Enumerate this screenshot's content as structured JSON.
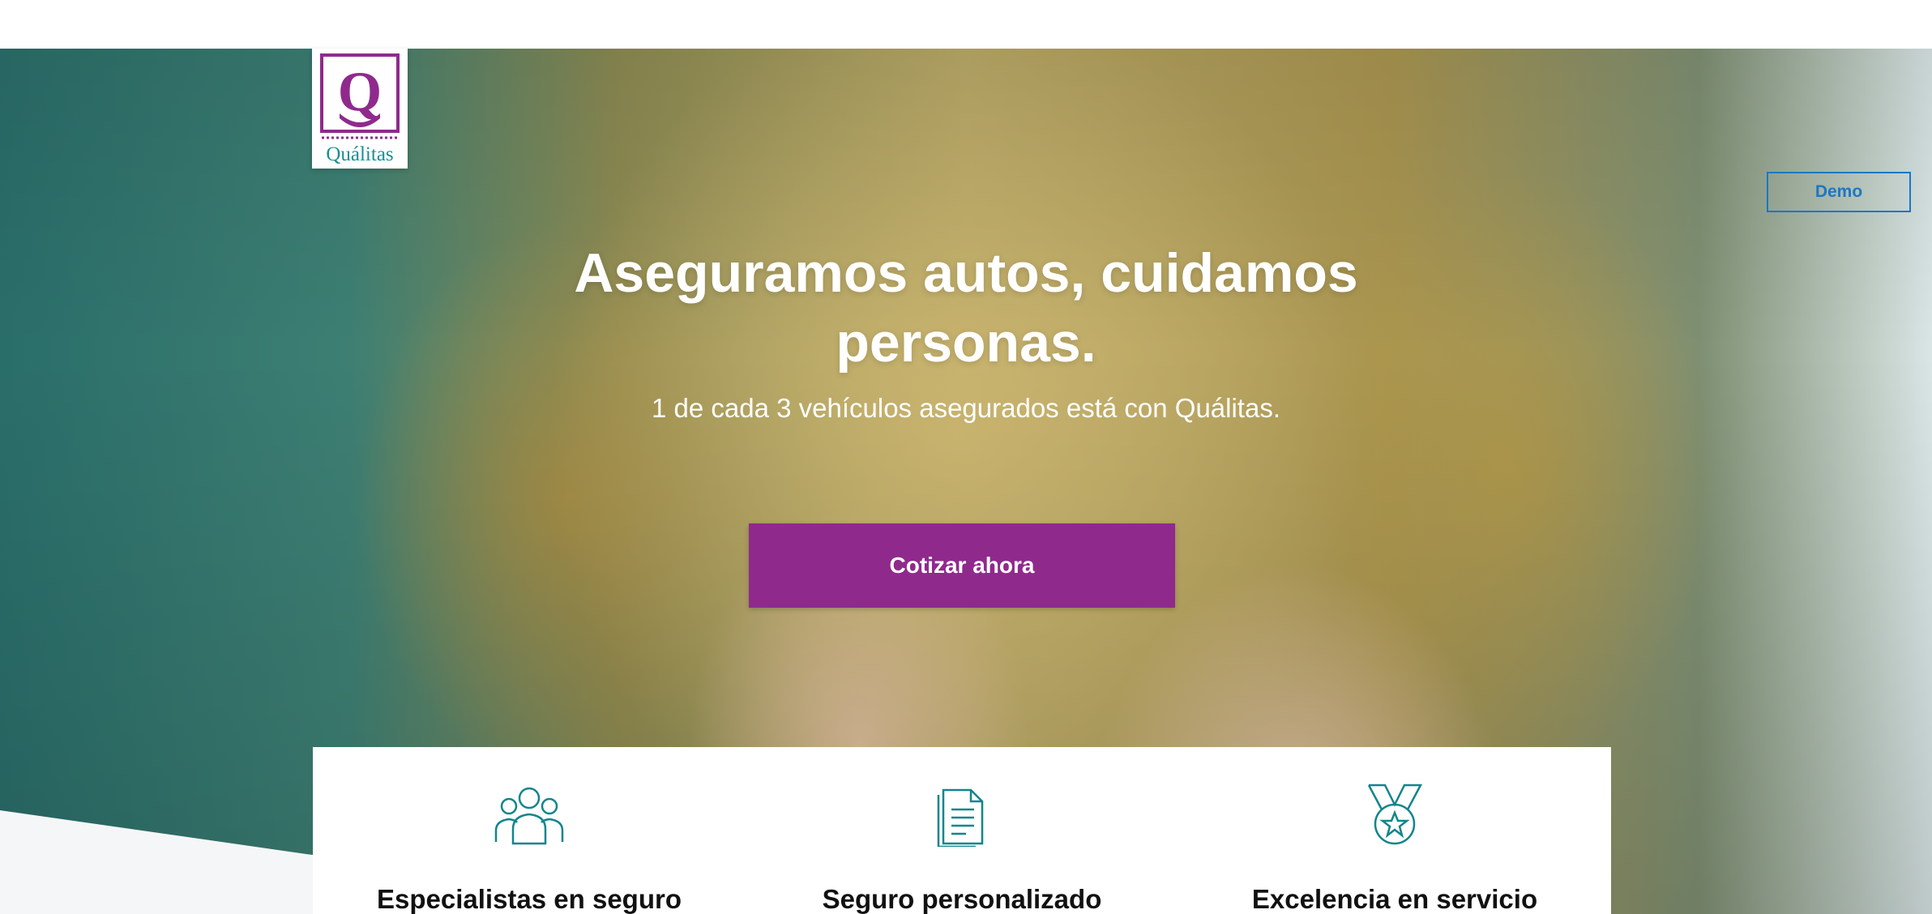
{
  "brand": {
    "logo_text": "Quálitas",
    "logo_letter": "Q",
    "color": "#8f2a8c"
  },
  "header": {
    "demo_label": "Demo",
    "demo_color": "#1b77c6"
  },
  "hero": {
    "title_line1": "Aseguramos autos, cuidamos",
    "title_line2": "personas.",
    "subtitle": "1 de cada 3 vehículos asegurados está con Quálitas.",
    "cta_label": "Cotizar ahora",
    "cta_color": "#8f2a8c"
  },
  "features": {
    "icon_color": "#12858c",
    "items": [
      {
        "icon": "people-group-icon",
        "label": "Especialistas en seguro"
      },
      {
        "icon": "document-icon",
        "label": "Seguro personalizado"
      },
      {
        "icon": "medal-star-icon",
        "label": "Excelencia en servicio"
      }
    ]
  }
}
